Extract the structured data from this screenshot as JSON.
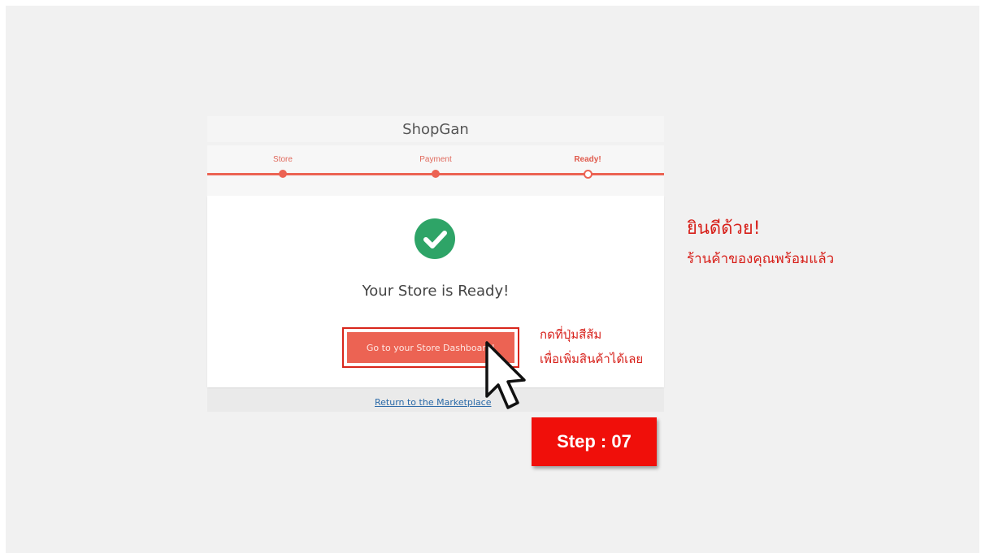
{
  "app": {
    "brand": "ShopGan"
  },
  "wizard": {
    "steps": [
      {
        "label": "Store",
        "state": "done"
      },
      {
        "label": "Payment",
        "state": "done"
      },
      {
        "label": "Ready!",
        "state": "current"
      }
    ],
    "accent_color": "#ec6353"
  },
  "card": {
    "status_icon": "check-circle-icon",
    "title": "Your Store is Ready!",
    "dashboard_button_label": "Go to your Store Dashboard!",
    "return_link": "Return to the Marketplace"
  },
  "annotations": {
    "button_hint_line1": "กดที่ปุ่มสีส้ม",
    "button_hint_line2": "เพื่อเพิ่มสินค้าได้เลย",
    "congrats_line1": "ยินดีด้วย!",
    "congrats_line2": "ร้านค้าของคุณพร้อมแล้ว",
    "step_badge": "Step : 07",
    "highlight_color": "#d7201a"
  }
}
